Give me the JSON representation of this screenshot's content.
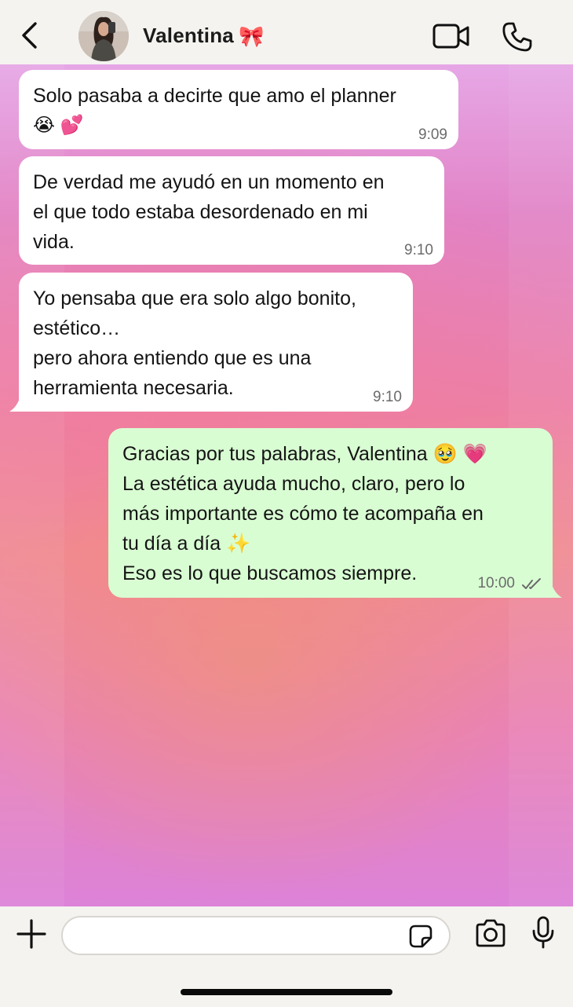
{
  "header": {
    "contact_name": "Valentina",
    "name_emoji": "🎀"
  },
  "messages": [
    {
      "direction": "incoming",
      "lines": [
        "Solo pasaba a decirte que amo el planner",
        "😭 💕"
      ],
      "time": "9:09"
    },
    {
      "direction": "incoming",
      "lines": [
        "De verdad me ayudó en un momento en",
        "el que todo estaba desordenado en mi",
        "vida."
      ],
      "time": "9:10"
    },
    {
      "direction": "incoming",
      "lines": [
        "Yo pensaba que era solo algo bonito,",
        "estético…",
        "pero ahora entiendo que es una",
        "herramienta necesaria."
      ],
      "time": "9:10"
    },
    {
      "direction": "outgoing",
      "lines": [
        "Gracias por tus palabras, Valentina 🥹 💗",
        "La estética ayuda mucho, claro, pero lo",
        "más importante es cómo te acompaña en",
        "tu día a día ✨",
        "Eso es lo que buscamos siempre."
      ],
      "time": "10:00",
      "status": "read"
    }
  ],
  "input": {
    "value": "",
    "placeholder": ""
  },
  "colors": {
    "incoming_bubble": "#ffffff",
    "outgoing_bubble": "#d9fdd3",
    "bar_background": "#f5f3ef"
  },
  "icons": {
    "back": "chevron-left-icon",
    "video": "video-camera-icon",
    "call": "phone-icon",
    "add": "plus-icon",
    "sticker": "sticker-icon",
    "camera": "camera-icon",
    "mic": "microphone-icon"
  }
}
